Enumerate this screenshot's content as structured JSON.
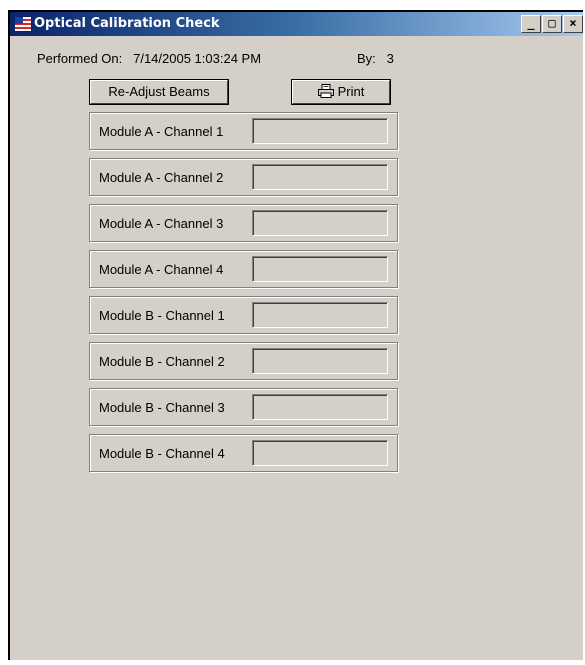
{
  "window": {
    "title": "Optical Calibration Check",
    "controls": [
      "_",
      "□",
      "×"
    ]
  },
  "header": {
    "performed_label": "Performed On:",
    "performed_value": "7/14/2005 1:03:24 PM",
    "by_label": "By:",
    "by_value": "3"
  },
  "buttons": {
    "readjust_label": "Re-Adjust Beams",
    "print_label": "Print"
  },
  "channels": [
    {
      "label": "Module A - Channel 1",
      "value": ""
    },
    {
      "label": "Module A - Channel 2",
      "value": ""
    },
    {
      "label": "Module A - Channel 3",
      "value": ""
    },
    {
      "label": "Module A - Channel 4",
      "value": ""
    },
    {
      "label": "Module B - Channel 1",
      "value": ""
    },
    {
      "label": "Module B - Channel 2",
      "value": ""
    },
    {
      "label": "Module B - Channel 3",
      "value": ""
    },
    {
      "label": "Module B - Channel 4",
      "value": ""
    }
  ],
  "icons": {
    "title": "app-flag-icon",
    "print": "printer-icon"
  }
}
